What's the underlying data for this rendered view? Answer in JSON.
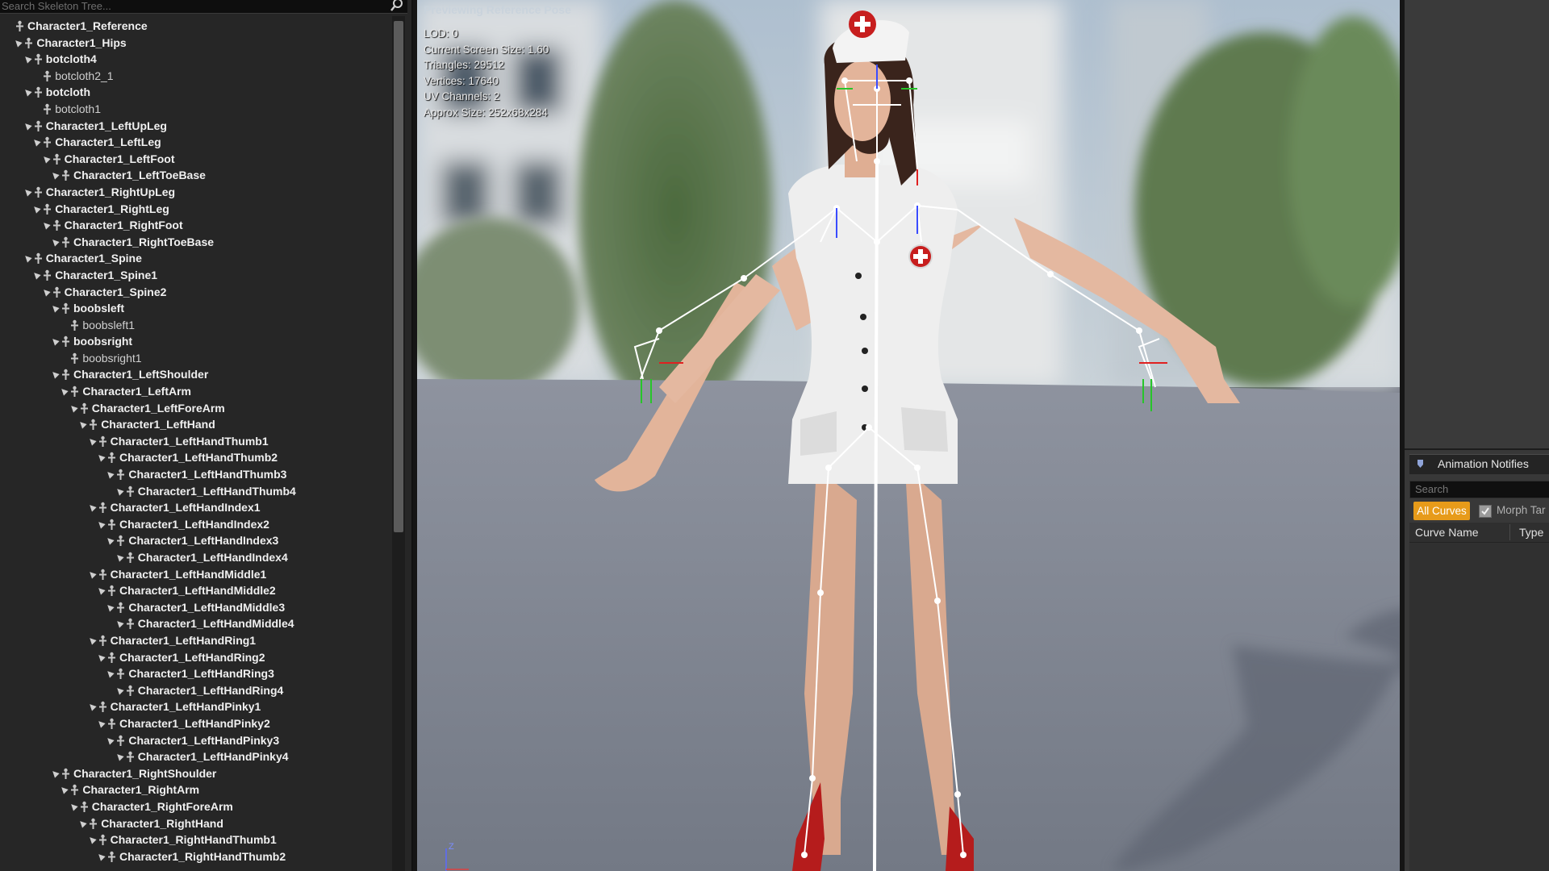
{
  "tree": {
    "search_placeholder": "Search Skeleton Tree...",
    "items": [
      {
        "label": "Character1_Reference",
        "depth": 0,
        "leaf": false
      },
      {
        "label": "Character1_Hips",
        "depth": 1,
        "leaf": false
      },
      {
        "label": "botcloth4",
        "depth": 2,
        "leaf": false
      },
      {
        "label": "botcloth2_1",
        "depth": 3,
        "leaf": true
      },
      {
        "label": "botcloth",
        "depth": 2,
        "leaf": false
      },
      {
        "label": "botcloth1",
        "depth": 3,
        "leaf": true
      },
      {
        "label": "Character1_LeftUpLeg",
        "depth": 2,
        "leaf": false
      },
      {
        "label": "Character1_LeftLeg",
        "depth": 3,
        "leaf": false
      },
      {
        "label": "Character1_LeftFoot",
        "depth": 4,
        "leaf": false
      },
      {
        "label": "Character1_LeftToeBase",
        "depth": 5,
        "leaf": false
      },
      {
        "label": "Character1_RightUpLeg",
        "depth": 2,
        "leaf": false
      },
      {
        "label": "Character1_RightLeg",
        "depth": 3,
        "leaf": false
      },
      {
        "label": "Character1_RightFoot",
        "depth": 4,
        "leaf": false
      },
      {
        "label": "Character1_RightToeBase",
        "depth": 5,
        "leaf": false
      },
      {
        "label": "Character1_Spine",
        "depth": 2,
        "leaf": false
      },
      {
        "label": "Character1_Spine1",
        "depth": 3,
        "leaf": false
      },
      {
        "label": "Character1_Spine2",
        "depth": 4,
        "leaf": false
      },
      {
        "label": "boobsleft",
        "depth": 5,
        "leaf": false
      },
      {
        "label": "boobsleft1",
        "depth": 6,
        "leaf": true
      },
      {
        "label": "boobsright",
        "depth": 5,
        "leaf": false
      },
      {
        "label": "boobsright1",
        "depth": 6,
        "leaf": true
      },
      {
        "label": "Character1_LeftShoulder",
        "depth": 5,
        "leaf": false
      },
      {
        "label": "Character1_LeftArm",
        "depth": 6,
        "leaf": false
      },
      {
        "label": "Character1_LeftForeArm",
        "depth": 7,
        "leaf": false
      },
      {
        "label": "Character1_LeftHand",
        "depth": 8,
        "leaf": false
      },
      {
        "label": "Character1_LeftHandThumb1",
        "depth": 9,
        "leaf": false
      },
      {
        "label": "Character1_LeftHandThumb2",
        "depth": 10,
        "leaf": false
      },
      {
        "label": "Character1_LeftHandThumb3",
        "depth": 11,
        "leaf": false
      },
      {
        "label": "Character1_LeftHandThumb4",
        "depth": 12,
        "leaf": false
      },
      {
        "label": "Character1_LeftHandIndex1",
        "depth": 9,
        "leaf": false
      },
      {
        "label": "Character1_LeftHandIndex2",
        "depth": 10,
        "leaf": false
      },
      {
        "label": "Character1_LeftHandIndex3",
        "depth": 11,
        "leaf": false
      },
      {
        "label": "Character1_LeftHandIndex4",
        "depth": 12,
        "leaf": false
      },
      {
        "label": "Character1_LeftHandMiddle1",
        "depth": 9,
        "leaf": false
      },
      {
        "label": "Character1_LeftHandMiddle2",
        "depth": 10,
        "leaf": false
      },
      {
        "label": "Character1_LeftHandMiddle3",
        "depth": 11,
        "leaf": false
      },
      {
        "label": "Character1_LeftHandMiddle4",
        "depth": 12,
        "leaf": false
      },
      {
        "label": "Character1_LeftHandRing1",
        "depth": 9,
        "leaf": false
      },
      {
        "label": "Character1_LeftHandRing2",
        "depth": 10,
        "leaf": false
      },
      {
        "label": "Character1_LeftHandRing3",
        "depth": 11,
        "leaf": false
      },
      {
        "label": "Character1_LeftHandRing4",
        "depth": 12,
        "leaf": false
      },
      {
        "label": "Character1_LeftHandPinky1",
        "depth": 9,
        "leaf": false
      },
      {
        "label": "Character1_LeftHandPinky2",
        "depth": 10,
        "leaf": false
      },
      {
        "label": "Character1_LeftHandPinky3",
        "depth": 11,
        "leaf": false
      },
      {
        "label": "Character1_LeftHandPinky4",
        "depth": 12,
        "leaf": false
      },
      {
        "label": "Character1_RightShoulder",
        "depth": 5,
        "leaf": false
      },
      {
        "label": "Character1_RightArm",
        "depth": 6,
        "leaf": false
      },
      {
        "label": "Character1_RightForeArm",
        "depth": 7,
        "leaf": false
      },
      {
        "label": "Character1_RightHand",
        "depth": 8,
        "leaf": false
      },
      {
        "label": "Character1_RightHandThumb1",
        "depth": 9,
        "leaf": false
      },
      {
        "label": "Character1_RightHandThumb2",
        "depth": 10,
        "leaf": false
      }
    ]
  },
  "viewport": {
    "title": "Previewing Reference Pose",
    "stats": [
      "LOD: 0",
      "Current Screen Size: 1.60",
      "Triangles: 29512",
      "Vertices: 17640",
      "UV Channels: 2",
      "Approx Size: 252x68x284"
    ],
    "axis_label": "Z"
  },
  "right_panel": {
    "notifies_tab": "Animation Notifies",
    "search_placeholder": "Search",
    "all_curves": "All Curves",
    "morph_label": "Morph Tar",
    "col_name": "Curve Name",
    "col_type": "Type"
  },
  "colors": {
    "accent": "#e79b1a",
    "panel": "#262626",
    "viewport_floor": "#7a8090"
  }
}
